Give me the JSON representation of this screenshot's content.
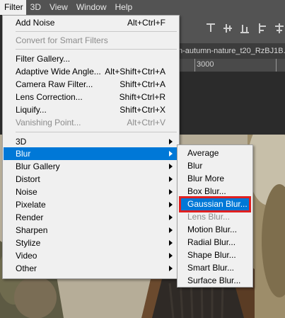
{
  "menubar": [
    {
      "label": "Filter",
      "active": true
    },
    {
      "label": "3D"
    },
    {
      "label": "View"
    },
    {
      "label": "Window"
    },
    {
      "label": "Help"
    }
  ],
  "doc_tab": {
    "title": "n-autumn-nature_t20_RzBJ1B..."
  },
  "ruler": {
    "label": "3000"
  },
  "filter_menu": {
    "add_noise": {
      "label": "Add Noise",
      "shortcut": "Alt+Ctrl+F"
    },
    "convert_smart": {
      "label": "Convert for Smart Filters"
    },
    "filter_gallery": {
      "label": "Filter Gallery..."
    },
    "adaptive_wide": {
      "label": "Adaptive Wide Angle...",
      "shortcut": "Alt+Shift+Ctrl+A"
    },
    "camera_raw": {
      "label": "Camera Raw Filter...",
      "shortcut": "Shift+Ctrl+A"
    },
    "lens_correction": {
      "label": "Lens Correction...",
      "shortcut": "Shift+Ctrl+R"
    },
    "liquify": {
      "label": "Liquify...",
      "shortcut": "Shift+Ctrl+X"
    },
    "vanishing_point": {
      "label": "Vanishing Point...",
      "shortcut": "Alt+Ctrl+V"
    },
    "submenus": [
      "3D",
      "Blur",
      "Blur Gallery",
      "Distort",
      "Noise",
      "Pixelate",
      "Render",
      "Sharpen",
      "Stylize",
      "Video",
      "Other"
    ]
  },
  "blur_submenu": {
    "items": [
      "Average",
      "Blur",
      "Blur More",
      "Box Blur...",
      "Gaussian Blur...",
      "Lens Blur...",
      "Motion Blur...",
      "Radial Blur...",
      "Shape Blur...",
      "Smart Blur...",
      "Surface Blur..."
    ]
  }
}
